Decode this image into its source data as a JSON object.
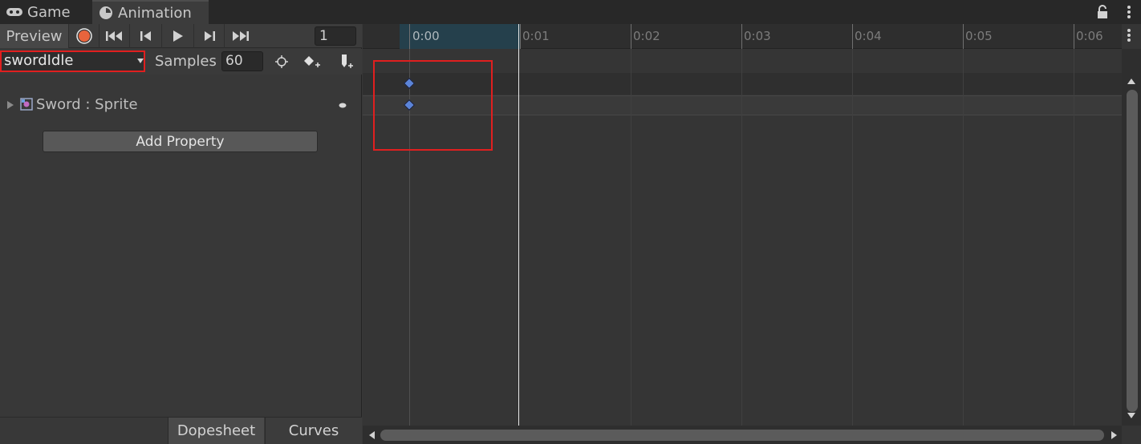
{
  "tabs": [
    {
      "label": "Game",
      "icon": "gamepad-icon"
    },
    {
      "label": "Animation",
      "icon": "clock-icon"
    }
  ],
  "toolbar": {
    "preview_label": "Preview",
    "frame_value": "1",
    "icons": [
      "record-icon",
      "first-key-icon",
      "prev-key-icon",
      "play-icon",
      "next-key-icon",
      "last-key-icon"
    ]
  },
  "clip": {
    "selected": "swordIdle",
    "samples_label": "Samples",
    "samples_value": "60",
    "tool_icons": [
      "filter-selection-icon",
      "add-keyframe-icon",
      "add-event-icon"
    ]
  },
  "properties": [
    {
      "label": "Sword : Sprite",
      "icon": "sprite-renderer-icon"
    }
  ],
  "add_property_label": "Add Property",
  "bottom_tabs": {
    "dopesheet": "Dopesheet",
    "curves": "Curves"
  },
  "timeline": {
    "tick_labels": [
      "0:00",
      "0:01",
      "0:02",
      "0:03",
      "0:04",
      "0:05",
      "0:06"
    ],
    "playhead_frame": 1,
    "keyframe_time": "0:00"
  },
  "colors": {
    "accent_record": "#e8643c",
    "keyframe": "#5b84d8",
    "highlight": "#e01f1f"
  }
}
